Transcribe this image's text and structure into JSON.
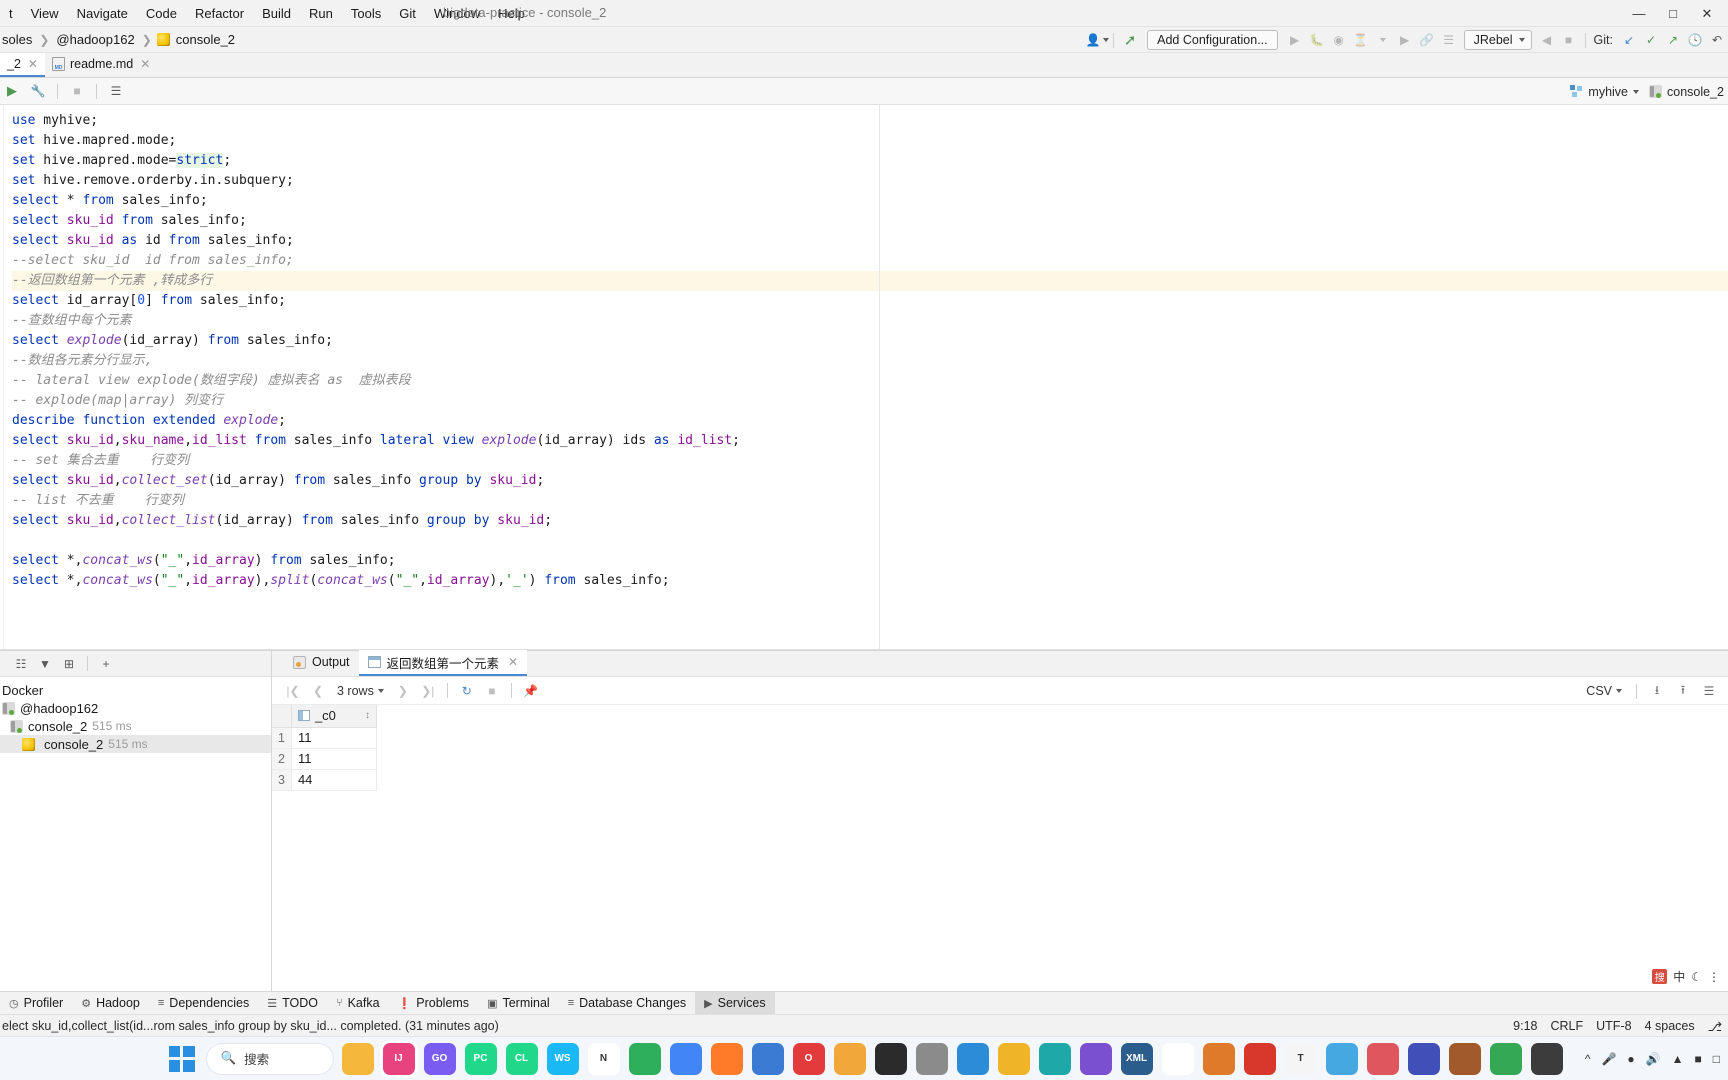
{
  "window": {
    "title": "bigdata-practice - console_2",
    "controls": [
      "minimize",
      "maximize",
      "close"
    ]
  },
  "menubar": {
    "items": [
      {
        "label": "t",
        "truncated": true
      },
      {
        "label": "View"
      },
      {
        "label": "Navigate"
      },
      {
        "label": "Code"
      },
      {
        "label": "Refactor"
      },
      {
        "label": "Build"
      },
      {
        "label": "Run"
      },
      {
        "label": "Tools"
      },
      {
        "label": "Git"
      },
      {
        "label": "Window"
      },
      {
        "label": "Help"
      }
    ]
  },
  "breadcrumb": {
    "items": [
      "soles",
      "@hadoop162",
      "console_2"
    ]
  },
  "toolbar": {
    "add_configuration": "Add Configuration...",
    "jrebel": "JRebel",
    "git_label": "Git:"
  },
  "editor_tabs": [
    {
      "label": "_2",
      "active": true,
      "closable": true
    },
    {
      "label": "readme.md",
      "active": false,
      "closable": true
    }
  ],
  "editor_toolbar": {
    "session_db": "myhive",
    "session_console": "console_2"
  },
  "code": {
    "lines": [
      {
        "t": "code",
        "tokens": [
          [
            "kw",
            "use"
          ],
          [
            "plain",
            " myhive;"
          ]
        ]
      },
      {
        "t": "code",
        "tokens": [
          [
            "kw",
            "set"
          ],
          [
            "plain",
            " hive.mapred.mode;"
          ]
        ]
      },
      {
        "t": "code",
        "tokens": [
          [
            "kw",
            "set"
          ],
          [
            "plain",
            " hive.mapred.mode="
          ],
          [
            "hl",
            "strict"
          ],
          [
            "plain",
            ";"
          ]
        ]
      },
      {
        "t": "code",
        "tokens": [
          [
            "kw",
            "set"
          ],
          [
            "plain",
            " hive.remove.orderby.in.subquery;"
          ]
        ]
      },
      {
        "t": "code",
        "tokens": [
          [
            "kw",
            "select"
          ],
          [
            "plain",
            " * "
          ],
          [
            "kw",
            "from"
          ],
          [
            "plain",
            " sales_info;"
          ]
        ]
      },
      {
        "t": "code",
        "tokens": [
          [
            "kw",
            "select"
          ],
          [
            "plain",
            " "
          ],
          [
            "ident",
            "sku_id"
          ],
          [
            "plain",
            " "
          ],
          [
            "kw",
            "from"
          ],
          [
            "plain",
            " sales_info;"
          ]
        ]
      },
      {
        "t": "code",
        "tokens": [
          [
            "kw",
            "select"
          ],
          [
            "plain",
            " "
          ],
          [
            "ident",
            "sku_id"
          ],
          [
            "plain",
            " "
          ],
          [
            "kw",
            "as"
          ],
          [
            "plain",
            " id "
          ],
          [
            "kw",
            "from"
          ],
          [
            "plain",
            " sales_info;"
          ]
        ]
      },
      {
        "t": "comment",
        "text": "--select sku_id  id from sales_info;"
      },
      {
        "t": "comment",
        "hl": true,
        "text": "--返回数组第一个元素 ,转成多行"
      },
      {
        "t": "code",
        "tokens": [
          [
            "kw",
            "select"
          ],
          [
            "plain",
            " id_array["
          ],
          [
            "num",
            "0"
          ],
          [
            "plain",
            "] "
          ],
          [
            "kw",
            "from"
          ],
          [
            "plain",
            " sales_info;"
          ]
        ]
      },
      {
        "t": "comment",
        "text": "--查数组中每个元素"
      },
      {
        "t": "code",
        "tokens": [
          [
            "kw",
            "select"
          ],
          [
            "plain",
            " "
          ],
          [
            "fn",
            "explode"
          ],
          [
            "plain",
            "(id_array) "
          ],
          [
            "kw",
            "from"
          ],
          [
            "plain",
            " sales_info;"
          ]
        ]
      },
      {
        "t": "comment",
        "text": "--数组各元素分行显示,"
      },
      {
        "t": "comment",
        "text": "-- lateral view explode(数组字段) 虚拟表名 as  虚拟表段"
      },
      {
        "t": "comment",
        "text": "-- explode(map|array) 列变行"
      },
      {
        "t": "code",
        "tokens": [
          [
            "kw",
            "describe"
          ],
          [
            "plain",
            " "
          ],
          [
            "kw",
            "function"
          ],
          [
            "plain",
            " "
          ],
          [
            "kw",
            "extended"
          ],
          [
            "plain",
            " "
          ],
          [
            "fn",
            "explode"
          ],
          [
            "plain",
            ";"
          ]
        ]
      },
      {
        "t": "code",
        "tokens": [
          [
            "kw",
            "select"
          ],
          [
            "plain",
            " "
          ],
          [
            "ident",
            "sku_id"
          ],
          [
            "plain",
            ","
          ],
          [
            "ident",
            "sku_name"
          ],
          [
            "plain",
            ","
          ],
          [
            "ident",
            "id_list"
          ],
          [
            "plain",
            " "
          ],
          [
            "kw",
            "from"
          ],
          [
            "plain",
            " sales_info "
          ],
          [
            "kw2",
            "lateral view"
          ],
          [
            "plain",
            " "
          ],
          [
            "fn",
            "explode"
          ],
          [
            "plain",
            "(id_array) ids "
          ],
          [
            "kw",
            "as"
          ],
          [
            "plain",
            " "
          ],
          [
            "ident",
            "id_list"
          ],
          [
            "plain",
            ";"
          ]
        ]
      },
      {
        "t": "comment",
        "text": "-- set 集合去重    行变列"
      },
      {
        "t": "code",
        "tokens": [
          [
            "kw",
            "select"
          ],
          [
            "plain",
            " "
          ],
          [
            "ident",
            "sku_id"
          ],
          [
            "plain",
            ","
          ],
          [
            "fn",
            "collect_set"
          ],
          [
            "plain",
            "(id_array) "
          ],
          [
            "kw",
            "from"
          ],
          [
            "plain",
            " sales_info "
          ],
          [
            "kw",
            "group by"
          ],
          [
            "plain",
            " "
          ],
          [
            "ident",
            "sku_id"
          ],
          [
            "plain",
            ";"
          ]
        ]
      },
      {
        "t": "comment",
        "text": "-- list 不去重    行变列"
      },
      {
        "t": "code",
        "tokens": [
          [
            "kw",
            "select"
          ],
          [
            "plain",
            " "
          ],
          [
            "ident",
            "sku_id"
          ],
          [
            "plain",
            ","
          ],
          [
            "fn",
            "collect_list"
          ],
          [
            "plain",
            "(id_array) "
          ],
          [
            "kw",
            "from"
          ],
          [
            "plain",
            " sales_info "
          ],
          [
            "kw",
            "group by"
          ],
          [
            "plain",
            " "
          ],
          [
            "ident",
            "sku_id"
          ],
          [
            "plain",
            ";"
          ]
        ]
      },
      {
        "t": "blank"
      },
      {
        "t": "code",
        "tokens": [
          [
            "kw",
            "select"
          ],
          [
            "plain",
            " *,"
          ],
          [
            "fn",
            "concat_ws"
          ],
          [
            "plain",
            "("
          ],
          [
            "str",
            "\"_\""
          ],
          [
            "plain",
            ","
          ],
          [
            "ident",
            "id_array"
          ],
          [
            "plain",
            ") "
          ],
          [
            "kw",
            "from"
          ],
          [
            "plain",
            " sales_info;"
          ]
        ]
      },
      {
        "t": "code",
        "tokens": [
          [
            "kw",
            "select"
          ],
          [
            "plain",
            " *,"
          ],
          [
            "fn",
            "concat_ws"
          ],
          [
            "plain",
            "("
          ],
          [
            "str",
            "\"_\""
          ],
          [
            "plain",
            ","
          ],
          [
            "ident",
            "id_array"
          ],
          [
            "plain",
            "),"
          ],
          [
            "fn",
            "split"
          ],
          [
            "plain",
            "("
          ],
          [
            "fn",
            "concat_ws"
          ],
          [
            "plain",
            "("
          ],
          [
            "str",
            "\"_\""
          ],
          [
            "plain",
            ","
          ],
          [
            "ident",
            "id_array"
          ],
          [
            "plain",
            "),"
          ],
          [
            "str",
            "'_'"
          ],
          [
            "plain",
            ") "
          ],
          [
            "kw",
            "from"
          ],
          [
            "plain",
            " sales_info;"
          ]
        ]
      }
    ]
  },
  "services": {
    "tree": [
      {
        "label": "Docker",
        "indent": 1,
        "time": "",
        "selected": false,
        "icon": "docker"
      },
      {
        "label": "@hadoop162",
        "indent": 1,
        "time": "",
        "selected": false,
        "icon": "db"
      },
      {
        "label": "console_2",
        "indent": 2,
        "time": "515 ms",
        "selected": false,
        "icon": "console"
      },
      {
        "label": "console_2",
        "indent": 3,
        "time": "515 ms",
        "selected": true,
        "icon": "hive"
      }
    ],
    "tabs": [
      {
        "label": "Output",
        "icon": "output-icon",
        "active": false,
        "closable": false
      },
      {
        "label": "返回数组第一个元素",
        "icon": "table-icon",
        "active": true,
        "closable": true
      }
    ],
    "grid_toolbar": {
      "rows_label": "3 rows",
      "format": "CSV"
    },
    "result_grid": {
      "columns": [
        "_c0"
      ],
      "rows": [
        {
          "n": "1",
          "values": [
            "11"
          ]
        },
        {
          "n": "2",
          "values": [
            "11"
          ]
        },
        {
          "n": "3",
          "values": [
            "44"
          ]
        }
      ]
    }
  },
  "ime": {
    "mode": "中"
  },
  "toolwindow_bar": {
    "items": [
      {
        "label": "Profiler",
        "icon": "profiler-icon",
        "active": false
      },
      {
        "label": "Hadoop",
        "icon": "hadoop-icon",
        "active": false
      },
      {
        "label": "Dependencies",
        "icon": "dependencies-icon",
        "active": false
      },
      {
        "label": "TODO",
        "icon": "todo-icon",
        "active": false
      },
      {
        "label": "Kafka",
        "icon": "kafka-icon",
        "active": false
      },
      {
        "label": "Problems",
        "icon": "problems-icon",
        "active": false
      },
      {
        "label": "Terminal",
        "icon": "terminal-icon",
        "active": false
      },
      {
        "label": "Database Changes",
        "icon": "database-changes-icon",
        "active": false
      },
      {
        "label": "Services",
        "icon": "services-icon",
        "active": true
      }
    ]
  },
  "statusbar": {
    "message": "elect sku_id,collect_list(id...rom sales_info group by sku_id... completed. (31 minutes ago)",
    "caret": "9:18",
    "line_sep": "CRLF",
    "encoding": "UTF-8",
    "indent": "4 spaces"
  },
  "taskbar": {
    "search_placeholder": "搜索",
    "apps": [
      {
        "name": "file-explorer",
        "short": "",
        "color": "#f5b83d"
      },
      {
        "name": "intellij-idea",
        "short": "IJ",
        "color": "#e8437f"
      },
      {
        "name": "goland",
        "short": "GO",
        "color": "#7a5cf0"
      },
      {
        "name": "pycharm",
        "short": "PC",
        "color": "#21d789"
      },
      {
        "name": "clion",
        "short": "CL",
        "color": "#21d789"
      },
      {
        "name": "webstorm",
        "short": "WS",
        "color": "#1ab8f5"
      },
      {
        "name": "navicat",
        "short": "N",
        "color": "#ffffff"
      },
      {
        "name": "app-green",
        "short": "",
        "color": "#2eaf5b"
      },
      {
        "name": "chrome",
        "short": "",
        "color": "#4285f4"
      },
      {
        "name": "firefox",
        "short": "",
        "color": "#ff7b29"
      },
      {
        "name": "app-blue",
        "short": "",
        "color": "#3b7bd4"
      },
      {
        "name": "opera",
        "short": "O",
        "color": "#e33b3b"
      },
      {
        "name": "chrome-alt",
        "short": "",
        "color": "#f2a73b"
      },
      {
        "name": "xmind",
        "short": "",
        "color": "#2b2b2b"
      },
      {
        "name": "app-grey",
        "short": "",
        "color": "#8b8b8b"
      },
      {
        "name": "vscode",
        "short": "",
        "color": "#2d8cd8"
      },
      {
        "name": "typora",
        "short": "",
        "color": "#f0b429"
      },
      {
        "name": "app-teal",
        "short": "",
        "color": "#1fa8a8"
      },
      {
        "name": "app-purple",
        "short": "",
        "color": "#7a4fd0"
      },
      {
        "name": "xml-app",
        "short": "XML",
        "color": "#2b5d8c"
      },
      {
        "name": "app-white",
        "short": "",
        "color": "#ffffff"
      },
      {
        "name": "app-orange",
        "short": "",
        "color": "#e07a2b"
      },
      {
        "name": "app-red",
        "short": "",
        "color": "#d8382b"
      },
      {
        "name": "typora-t",
        "short": "T",
        "color": "#f5f5f5"
      },
      {
        "name": "app-sky",
        "short": "",
        "color": "#46a8e0"
      },
      {
        "name": "app-rose",
        "short": "",
        "color": "#e0565f"
      },
      {
        "name": "app-indigo",
        "short": "",
        "color": "#4150b8"
      },
      {
        "name": "app-brown",
        "short": "",
        "color": "#a05a2b"
      },
      {
        "name": "chrome2",
        "short": "",
        "color": "#34a853"
      },
      {
        "name": "app-dark",
        "short": "",
        "color": "#3c3c3c"
      }
    ]
  }
}
